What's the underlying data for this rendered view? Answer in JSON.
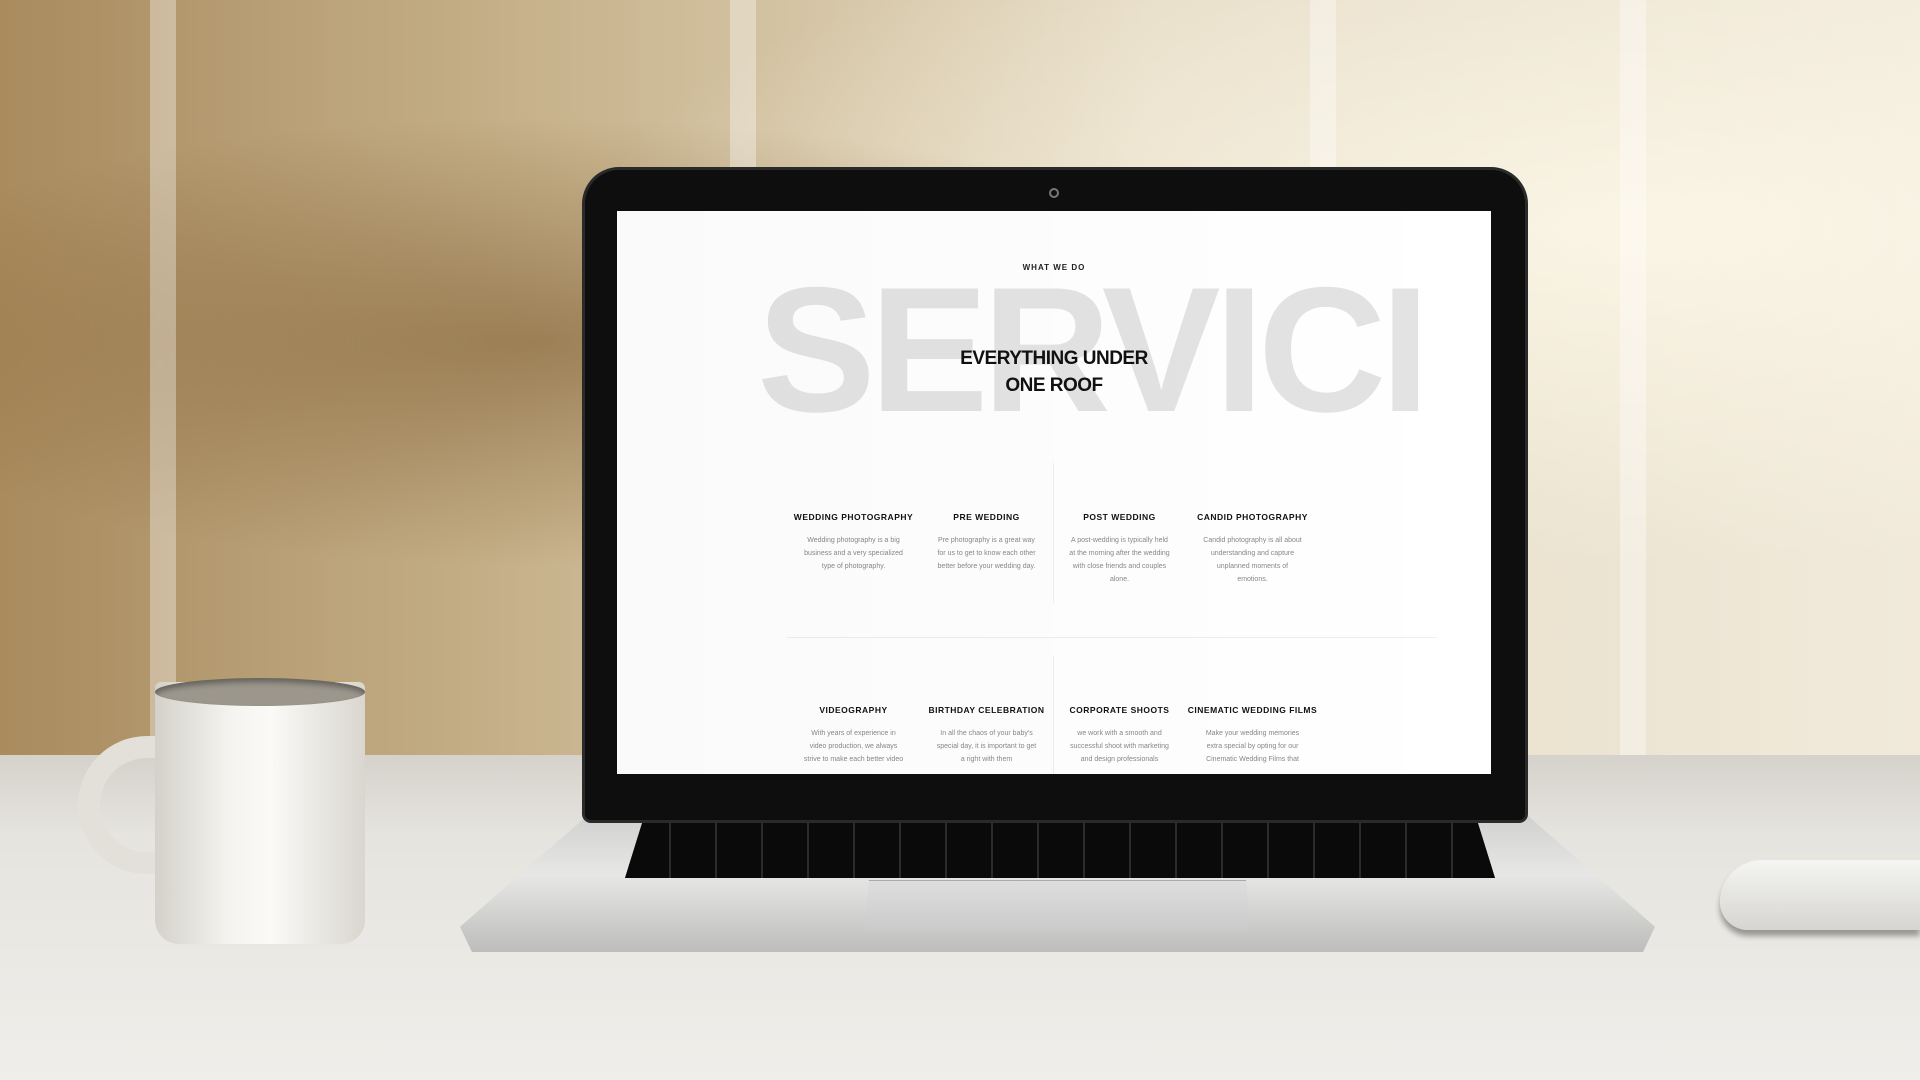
{
  "screen": {
    "eyebrow": "WHAT WE DO",
    "background_word": "SERVICI",
    "headline_line1": "EVERYTHING UNDER",
    "headline_line2": "ONE ROOF",
    "services_row1": [
      {
        "title": "WEDDING PHOTOGRAPHY",
        "desc": "Wedding photography is a big business and a very specialized type of photography."
      },
      {
        "title": "PRE WEDDING",
        "desc": "Pre photography is a great way for us to get to know each other better before your wedding day."
      },
      {
        "title": "POST WEDDING",
        "desc": "A post-wedding is typically held at the morning after the wedding with close friends and couples alone."
      },
      {
        "title": "CANDID PHOTOGRAPHY",
        "desc": "Candid photography is all about understanding and capture unplanned moments of emotions."
      }
    ],
    "services_row2": [
      {
        "title": "VIDEOGRAPHY",
        "desc": "With years of experience in video production, we always strive to make each better video"
      },
      {
        "title": "BIRTHDAY CELEBRATION",
        "desc": "In all the chaos of your baby's special day, it is important to get a right with them"
      },
      {
        "title": "CORPORATE SHOOTS",
        "desc": "we work with a smooth and successful shoot with marketing and design professionals"
      },
      {
        "title": "CINEMATIC WEDDING FILMS",
        "desc": "Make your wedding memories extra special by opting for our Cinematic Wedding Films that"
      }
    ]
  },
  "colors": {
    "bigword": "#e3e3e3",
    "screen_bg": "#ffffff",
    "text_dark": "#111111",
    "text_muted": "#888888"
  }
}
